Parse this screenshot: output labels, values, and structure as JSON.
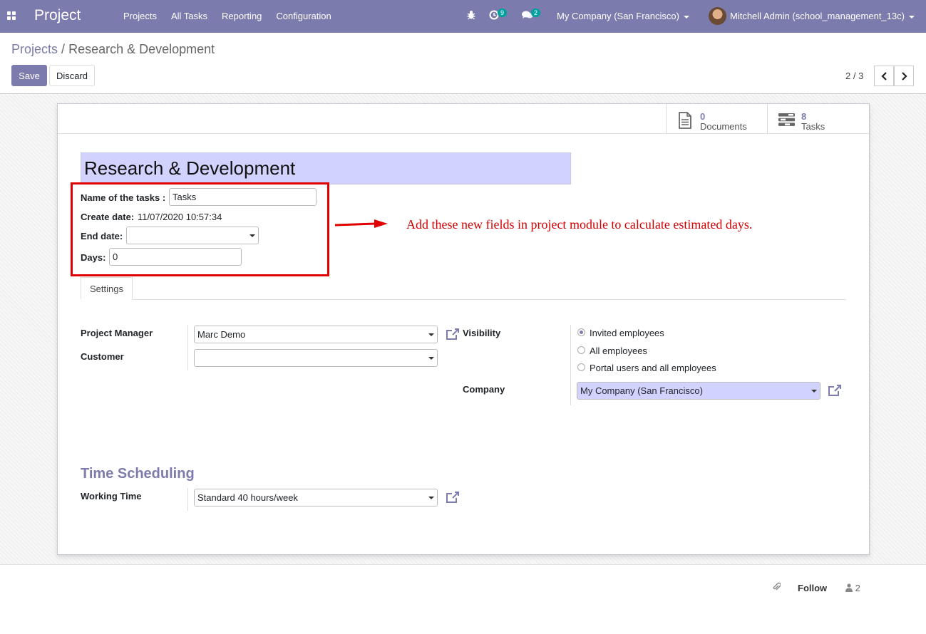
{
  "navbar": {
    "app_name": "Project",
    "menu": [
      "Projects",
      "All Tasks",
      "Reporting",
      "Configuration"
    ],
    "activity_badge": "9",
    "message_badge": "2",
    "company": "My Company (San Francisco)",
    "user": "Mitchell Admin (school_management_13c)"
  },
  "breadcrumb": {
    "parent": "Projects",
    "separator": "/",
    "current": "Research & Development"
  },
  "toolbar": {
    "save_label": "Save",
    "discard_label": "Discard"
  },
  "pager": {
    "value": "2 / 3"
  },
  "stat_buttons": {
    "documents": {
      "value": "0",
      "label": "Documents"
    },
    "tasks": {
      "value": "8",
      "label": "Tasks"
    }
  },
  "form": {
    "name": "Research & Development",
    "tasks_name_label": "Name of the tasks :",
    "tasks_name_value": "Tasks",
    "create_date_label": "Create date:",
    "create_date_value": "11/07/2020 10:57:34",
    "end_date_label": "End date:",
    "end_date_value": "",
    "days_label": "Days:",
    "days_value": "0"
  },
  "annotation": "Add these new fields in project module to calculate estimated days.",
  "tabs": [
    "Settings"
  ],
  "settings": {
    "project_manager_label": "Project Manager",
    "project_manager_value": "Marc Demo",
    "customer_label": "Customer",
    "customer_value": "",
    "visibility_label": "Visibility",
    "visibility_options": [
      "Invited employees",
      "All employees",
      "Portal users and all employees"
    ],
    "visibility_selected": "Invited employees",
    "company_label": "Company",
    "company_value": "My Company (San Francisco)"
  },
  "time_scheduling": {
    "title": "Time Scheduling",
    "working_time_label": "Working Time",
    "working_time_value": "Standard 40 hours/week"
  },
  "chatter": {
    "follow_label": "Follow",
    "followers_count": "2"
  },
  "colors": {
    "brand": "#7c7bad",
    "required_field": "#d2d2ff",
    "annotation_red": "#e00000"
  }
}
